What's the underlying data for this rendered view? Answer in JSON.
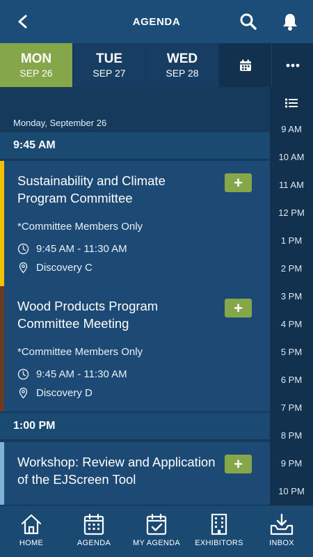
{
  "header": {
    "title": "AGENDA"
  },
  "day_tabs": [
    {
      "day": "MON",
      "date": "SEP 26",
      "active": true
    },
    {
      "day": "TUE",
      "date": "SEP 27",
      "active": false
    },
    {
      "day": "WED",
      "date": "SEP 28",
      "active": false
    }
  ],
  "agenda": {
    "date_heading": "Monday, September 26",
    "time_headers": [
      "9:45 AM",
      "1:00 PM"
    ],
    "sessions": [
      {
        "title": "Sustainability and Climate Program Committee",
        "note": "*Committee Members Only",
        "time": "9:45 AM - 11:30 AM",
        "location": "Discovery C",
        "accent": "#f2c200",
        "add": "+"
      },
      {
        "title": "Wood Products Program Committee Meeting",
        "note": "*Committee Members Only",
        "time": "9:45 AM - 11:30 AM",
        "location": "Discovery D",
        "accent": "#6b3b1f",
        "add": "+"
      },
      {
        "title": "Workshop: Review and Application of the EJScreen Tool",
        "accent": "#7fb3d5",
        "add": "+"
      }
    ]
  },
  "time_rail": [
    "9 AM",
    "10 AM",
    "11 AM",
    "12 PM",
    "1 PM",
    "2 PM",
    "3 PM",
    "4 PM",
    "5 PM",
    "6 PM",
    "7 PM",
    "8 PM",
    "9 PM",
    "10 PM"
  ],
  "bottom_nav": [
    {
      "label": "HOME",
      "icon": "home-icon"
    },
    {
      "label": "AGENDA",
      "icon": "calendar-icon"
    },
    {
      "label": "MY AGENDA",
      "icon": "calendar-check-icon"
    },
    {
      "label": "EXHIBITORS",
      "icon": "building-icon"
    },
    {
      "label": "INBOX",
      "icon": "inbox-download-icon"
    }
  ],
  "colors": {
    "header_bg": "#1b4d78",
    "active_tab": "#86a64a",
    "page_bg": "#163a5c",
    "card_bg": "#1c4a74",
    "rail_bg": "#12314f"
  }
}
